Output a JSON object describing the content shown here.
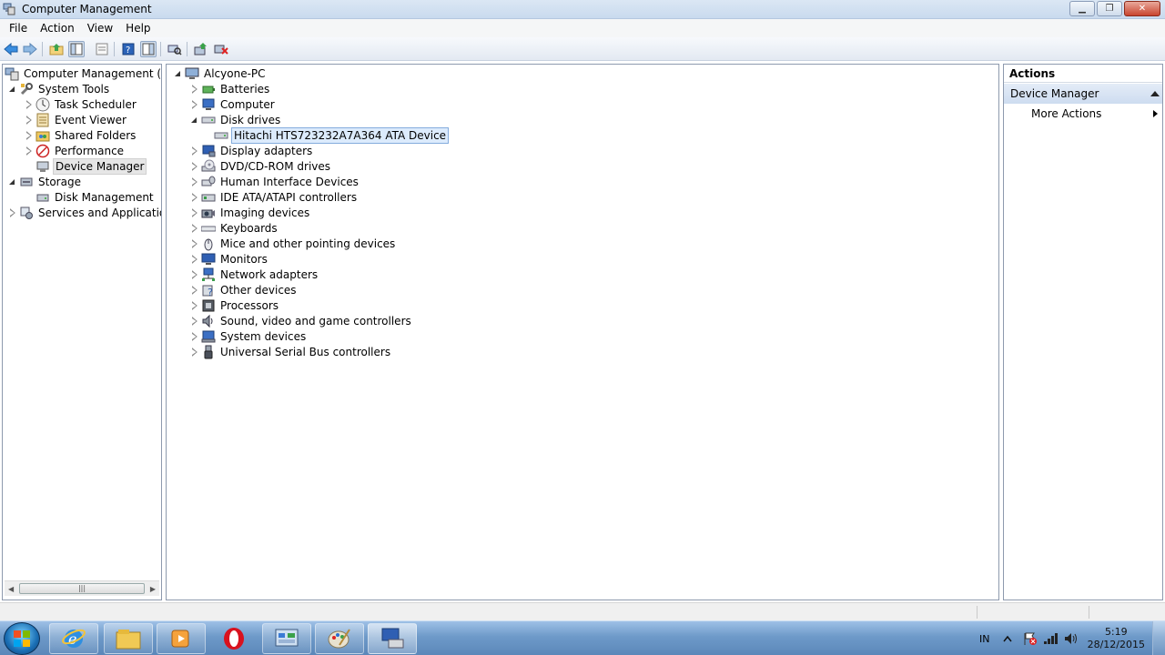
{
  "window": {
    "title": "Computer Management"
  },
  "menu": [
    "File",
    "Action",
    "View",
    "Help"
  ],
  "left_tree": {
    "root": "Computer Management (Local",
    "system_tools": "System Tools",
    "task_scheduler": "Task Scheduler",
    "event_viewer": "Event Viewer",
    "shared_folders": "Shared Folders",
    "performance": "Performance",
    "device_manager": "Device Manager",
    "storage": "Storage",
    "disk_management": "Disk Management",
    "services": "Services and Applications"
  },
  "device_tree": {
    "computer": "Alcyone-PC",
    "categories": [
      "Batteries",
      "Computer",
      "Disk drives",
      "Display adapters",
      "DVD/CD-ROM drives",
      "Human Interface Devices",
      "IDE ATA/ATAPI controllers",
      "Imaging devices",
      "Keyboards",
      "Mice and other pointing devices",
      "Monitors",
      "Network adapters",
      "Other devices",
      "Processors",
      "Sound, video and game controllers",
      "System devices",
      "Universal Serial Bus controllers"
    ],
    "disk_device": "Hitachi HTS723232A7A364 ATA Device"
  },
  "actions": {
    "header": "Actions",
    "section": "Device Manager",
    "more": "More Actions"
  },
  "tray": {
    "lang": "IN",
    "time": "5:19",
    "date": "28/12/2015"
  }
}
